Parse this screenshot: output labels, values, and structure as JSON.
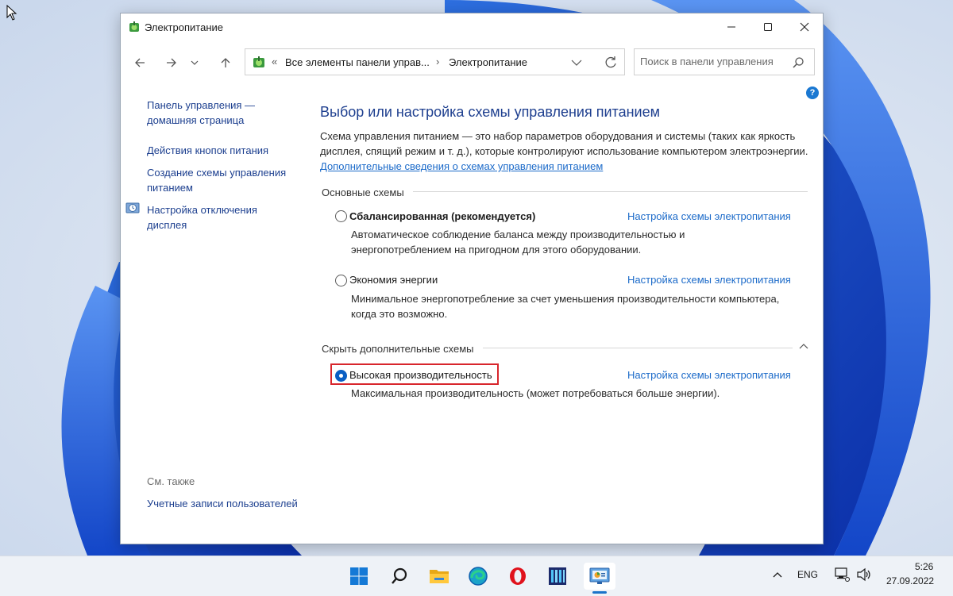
{
  "window": {
    "title": "Электропитание",
    "buttons": {
      "minimize": "minimize-icon",
      "maximize": "maximize-icon",
      "close": "close-icon"
    }
  },
  "nav": {
    "breadcrumb_prefix": "«",
    "breadcrumb": [
      "Все элементы панели управ...",
      "Электропитание"
    ],
    "breadcrumb_separator": "›",
    "search_placeholder": "Поиск в панели управления"
  },
  "sidebar": {
    "links": [
      {
        "label": "Панель управления — домашняя страница"
      },
      {
        "label": "Действия кнопок питания"
      },
      {
        "label": "Создание схемы управления питанием"
      },
      {
        "label": "Настройка отключения дисплея"
      }
    ],
    "see_also_title": "См. также",
    "see_also_links": [
      {
        "label": "Учетные записи пользователей"
      }
    ]
  },
  "main": {
    "heading": "Выбор или настройка схемы управления питанием",
    "description": "Схема управления питанием — это набор параметров оборудования и системы (таких как яркость дисплея, спящий режим и т. д.), которые контролируют использование компьютером электроэнергии.",
    "description_link": "Дополнительные сведения о схемах управления питанием",
    "primary_group_title": "Основные схемы",
    "hidden_group_title": "Скрыть дополнительные схемы",
    "plans": [
      {
        "name": "Сбалансированная (рекомендуется)",
        "description": "Автоматическое соблюдение баланса между производительностью и энергопотреблением на пригодном для этого оборудовании.",
        "link": "Настройка схемы электропитания",
        "selected": false
      },
      {
        "name": "Экономия энергии",
        "description": "Минимальное энергопотребление за счет уменьшения производительности компьютера, когда это возможно.",
        "link": "Настройка схемы электропитания",
        "selected": false
      },
      {
        "name": "Высокая производительность",
        "description": "Максимальная производительность (может потребоваться больше энергии).",
        "link": "Настройка схемы электропитания",
        "selected": true
      }
    ]
  },
  "taskbar": {
    "apps": [
      "start-icon",
      "search-icon",
      "file-explorer-icon",
      "edge-icon",
      "opera-icon",
      "app-icon",
      "control-panel-icon"
    ],
    "language": "ENG",
    "time": "5:26",
    "date": "27.09.2022"
  },
  "colors": {
    "accent": "#1a73c9",
    "link": "#1b6ac9",
    "heading": "#1e3f8f",
    "highlight": "#d8262c"
  }
}
